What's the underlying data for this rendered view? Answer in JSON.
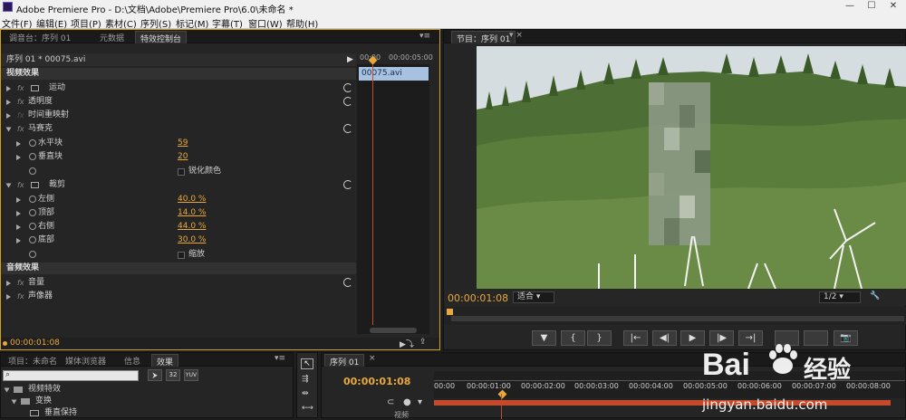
{
  "window": {
    "title": "Adobe Premiere Pro - D:\\文档\\Adobe\\Premiere Pro\\6.0\\未命名 *",
    "min": "—",
    "max": "☐",
    "close": "✕"
  },
  "menu": [
    "文件(F)",
    "编辑(E)",
    "项目(P)",
    "素材(C)",
    "序列(S)",
    "标记(M)",
    "字幕(T)",
    "窗口(W)",
    "帮助(H)"
  ],
  "effect_controls": {
    "tabs": [
      "调音台：序列 01",
      "元数据",
      "特效控制台"
    ],
    "sequence_clip": "序列 01 * 00075.avi",
    "ruler": [
      "00:00",
      "00:00:05:00"
    ],
    "clip_name": "00075.avi",
    "video_effects_label": "视频效果",
    "audio_effects_label": "音频效果",
    "fx": "fx",
    "effects": [
      {
        "name": "运动"
      },
      {
        "name": "透明度"
      },
      {
        "name": "时间重映射"
      },
      {
        "name": "马赛克"
      },
      {
        "name": "裁剪"
      },
      {
        "name": "音量"
      },
      {
        "name": "声像器"
      }
    ],
    "mosaic_params": [
      {
        "name": "水平块",
        "value": "59"
      },
      {
        "name": "垂直块",
        "value": "20"
      }
    ],
    "sharpen_label": "锐化颜色",
    "crop_params": [
      {
        "name": "左侧",
        "value": "40.0 %"
      },
      {
        "name": "顶部",
        "value": "14.0 %"
      },
      {
        "name": "右侧",
        "value": "44.0 %"
      },
      {
        "name": "底部",
        "value": "30.0 %"
      }
    ],
    "zoom_label": "缩放",
    "current_time": "00:00:01:08"
  },
  "program": {
    "tab": "节目：序列 01",
    "timecode": "00:00:01:08",
    "fit": "适合",
    "quality": "1/2",
    "controls": [
      "▼",
      "{",
      "}",
      "|←",
      "◀|",
      "▶",
      "|▶",
      "→|",
      "",
      "",
      "📷"
    ]
  },
  "project": {
    "tabs": [
      "项目：未命名",
      "媒体浏览器",
      "信息",
      "效果"
    ],
    "tree": [
      "视频特效",
      "变换",
      "垂直保持"
    ],
    "icon_labels": [
      "32",
      "YUV"
    ]
  },
  "timeline": {
    "tab": "序列 01",
    "timecode": "00:00:01:08",
    "ruler": [
      "00:00",
      "00:00:01:00",
      "00:00:02:00",
      "00:00:03:00",
      "00:00:04:00",
      "00:00:05:00",
      "00:00:06:00",
      "00:00:07:00",
      "00:00:08:00"
    ],
    "track_label": "视频"
  },
  "watermark": {
    "brand": "Bai",
    "brand2": "经验",
    "url": "jingyan.baidu.com"
  },
  "colors": {
    "accent": "#e8a93a",
    "playhead": "#c44a2b",
    "panel": "#252525",
    "clip": "#a7c1e0"
  }
}
